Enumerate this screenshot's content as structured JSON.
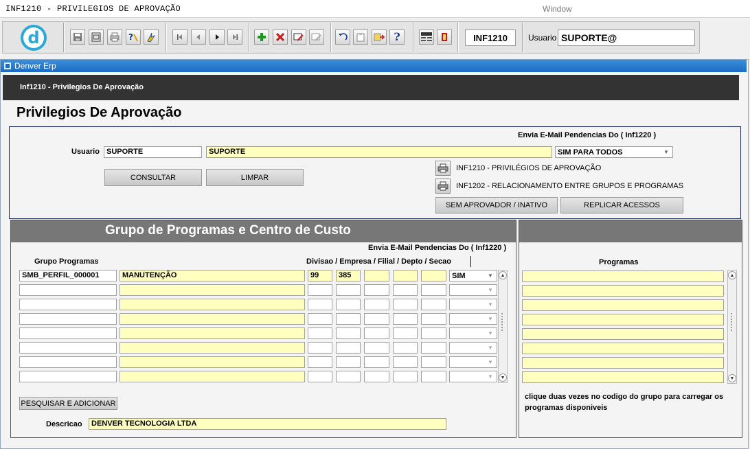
{
  "titlebar": {
    "title": "INF1210 - PRIVILEGIOS DE APROVAÇÃO",
    "window_menu": "Window"
  },
  "toolbar": {
    "form_code": "INF1210",
    "user_label": "Usuario",
    "user_value": "SUPORTE@",
    "logo_letter": "d"
  },
  "window": {
    "title": "Denver Erp",
    "header": "Inf1210 - Privilegios De Aprovação",
    "page_title": "Privilegios De Aprovação"
  },
  "filter": {
    "email_header": "Envia E-Mail Pendencias Do ( Inf1220 )",
    "usuario_label": "Usuario",
    "usuario_code": "SUPORTE",
    "usuario_name": "SUPORTE",
    "email_option": "SIM PARA TODOS",
    "consultar": "CONSULTAR",
    "limpar": "LIMPAR",
    "report1": "INF1210 - PRIVILÉGIOS DE APROVAÇÃO",
    "report2": "INF1202 - RELACIONAMENTO ENTRE GRUPOS E PROGRAMAS",
    "sem_aprovador": "SEM APROVADOR / INATIVO",
    "replicar": "REPLICAR ACESSOS"
  },
  "grid": {
    "title": "Grupo de Programas e Centro de Custo",
    "email_header": "Envia E-Mail Pendencias Do ( Inf1220 )",
    "col_grupo": "Grupo Programas",
    "col_divisao": "Divisao / Empresa / Filial / Depto / Secao",
    "rows": [
      {
        "grupo": "SMB_PERFIL_000001",
        "descricao": "MANUTENÇÃO",
        "divisao": "99",
        "empresa": "385",
        "filial": "",
        "depto": "",
        "secao": "",
        "email": "SIM"
      },
      {
        "grupo": "",
        "descricao": "",
        "divisao": "",
        "empresa": "",
        "filial": "",
        "depto": "",
        "secao": "",
        "email": ""
      },
      {
        "grupo": "",
        "descricao": "",
        "divisao": "",
        "empresa": "",
        "filial": "",
        "depto": "",
        "secao": "",
        "email": ""
      },
      {
        "grupo": "",
        "descricao": "",
        "divisao": "",
        "empresa": "",
        "filial": "",
        "depto": "",
        "secao": "",
        "email": ""
      },
      {
        "grupo": "",
        "descricao": "",
        "divisao": "",
        "empresa": "",
        "filial": "",
        "depto": "",
        "secao": "",
        "email": ""
      },
      {
        "grupo": "",
        "descricao": "",
        "divisao": "",
        "empresa": "",
        "filial": "",
        "depto": "",
        "secao": "",
        "email": ""
      },
      {
        "grupo": "",
        "descricao": "",
        "divisao": "",
        "empresa": "",
        "filial": "",
        "depto": "",
        "secao": "",
        "email": ""
      },
      {
        "grupo": "",
        "descricao": "",
        "divisao": "",
        "empresa": "",
        "filial": "",
        "depto": "",
        "secao": "",
        "email": ""
      }
    ],
    "pesquisar": "PESQUISAR E ADICIONAR",
    "descricao_label": "Descricao",
    "descricao_value": "DENVER TECNOLOGIA LTDA"
  },
  "programs": {
    "header": "Programas",
    "rows": [
      "",
      "",
      "",
      "",
      "",
      "",
      "",
      ""
    ],
    "hint": "clique duas vezes no codigo do grupo para carregar os programas disponiveis"
  },
  "colors": {
    "accent": "#1a6cc4",
    "field_yellow": "#ffffc0",
    "header_dark": "#333333",
    "section_gray": "#777777"
  },
  "icons": {
    "toolbar": [
      "save-icon",
      "window-icon",
      "print-icon",
      "query-icon",
      "execute-query-icon",
      "first-record-icon",
      "previous-record-icon",
      "next-record-icon",
      "last-record-icon",
      "insert-record-icon",
      "delete-record-icon",
      "edit-record-icon",
      "duplicate-record-icon",
      "undo-icon",
      "clipboard-icon",
      "list-values-icon",
      "help-icon",
      "menu-icon",
      "exit-icon"
    ]
  }
}
